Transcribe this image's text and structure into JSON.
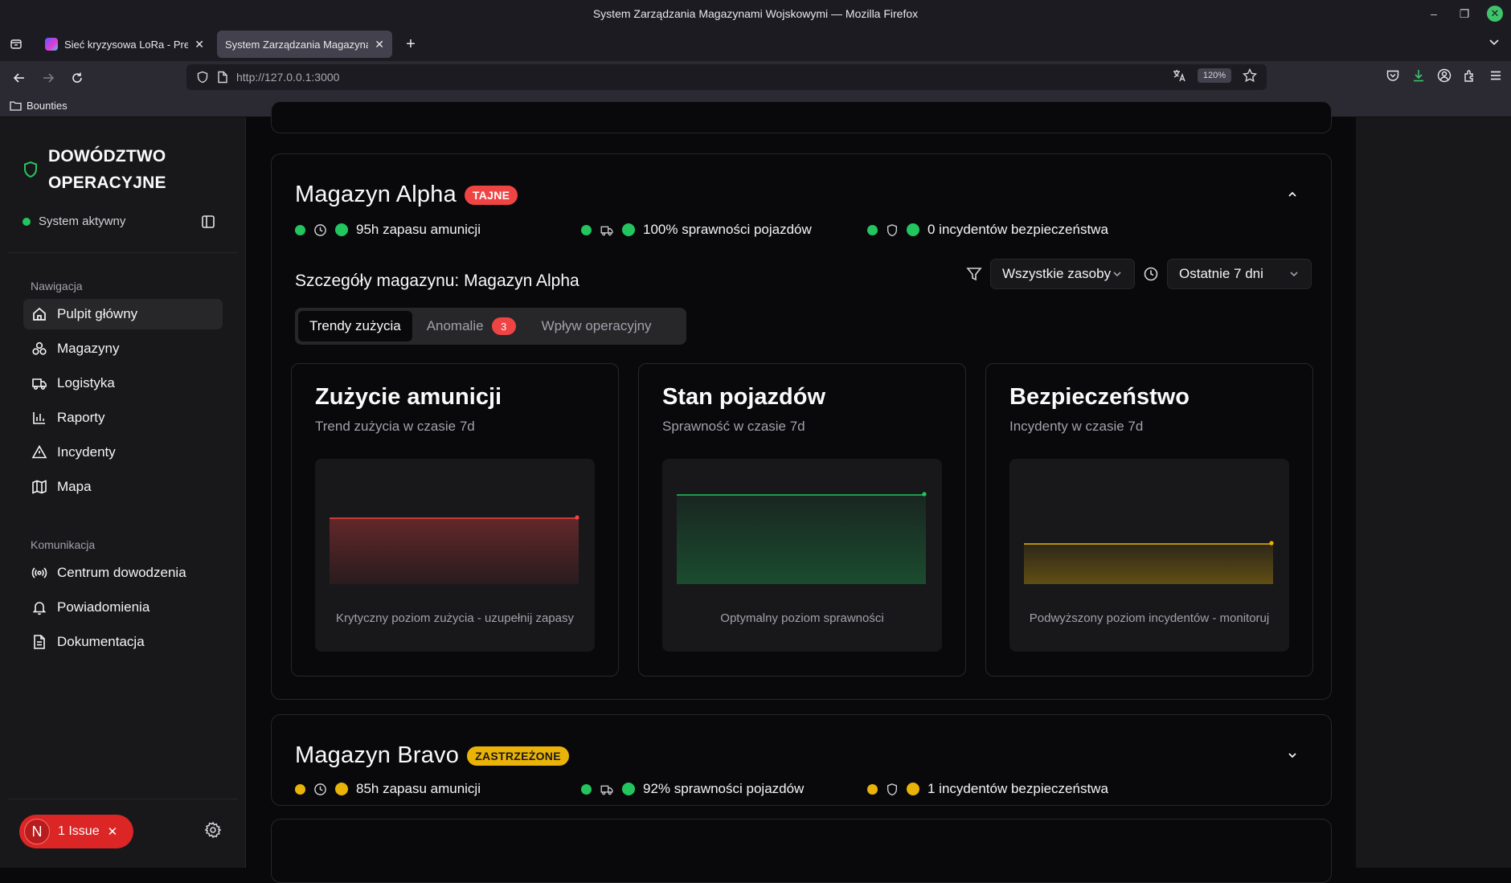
{
  "browser": {
    "window_title": "System Zarządzania Magazynami Wojskowymi — Mozilla Firefox",
    "tabs": [
      {
        "label": "Sieć kryzysowa LoRa - Prese"
      },
      {
        "label": "System Zarządzania Magazynami"
      }
    ],
    "url": "http://127.0.0.1:3000",
    "zoom": "120%",
    "bookmarks": [
      {
        "label": "Bounties"
      }
    ]
  },
  "sidebar": {
    "brand": {
      "line1": "DOWÓDZTWO",
      "line2": "OPERACYJNE"
    },
    "status": "System aktywny",
    "nav_label": "Nawigacja",
    "nav": [
      {
        "label": "Pulpit główny",
        "icon": "home-icon",
        "active": true
      },
      {
        "label": "Magazyny",
        "icon": "boxes-icon"
      },
      {
        "label": "Logistyka",
        "icon": "truck-icon"
      },
      {
        "label": "Raporty",
        "icon": "bar-chart-icon"
      },
      {
        "label": "Incydenty",
        "icon": "warning-icon"
      },
      {
        "label": "Mapa",
        "icon": "map-icon"
      }
    ],
    "comm_label": "Komunikacja",
    "comm": [
      {
        "label": "Centrum dowodzenia",
        "icon": "radio-icon"
      },
      {
        "label": "Powiadomienia",
        "icon": "bell-icon"
      },
      {
        "label": "Dokumentacja",
        "icon": "document-icon"
      }
    ],
    "issue": {
      "avatar": "N",
      "label": "1 Issue"
    }
  },
  "warehouses": [
    {
      "name": "Magazyn Alpha",
      "badge": "TAJNE",
      "badge_color": "#ef4444",
      "metrics": {
        "ammo": "95h zapasu amunicji",
        "vehicles": "100% sprawności pojazdów",
        "security": "0 incydentów bezpieczeństwa"
      },
      "metric_status": [
        "green",
        "green",
        "green"
      ]
    },
    {
      "name": "Magazyn Bravo",
      "badge": "ZASTRZEŻONE",
      "badge_color": "#eab308",
      "metrics": {
        "ammo": "85h zapasu amunicji",
        "vehicles": "92% sprawności pojazdów",
        "security": "1 incydentów bezpieczeństwa"
      },
      "metric_status": [
        "yellow",
        "green",
        "yellow"
      ]
    }
  ],
  "details": {
    "title": "Szczegóły magazynu: Magazyn Alpha",
    "filter_resources": "Wszystkie zasoby",
    "filter_period": "Ostatnie 7 dni",
    "tabs": [
      {
        "label": "Trendy zużycia",
        "active": true
      },
      {
        "label": "Anomalie",
        "count": "3"
      },
      {
        "label": "Wpływ operacyjny"
      }
    ],
    "panels": [
      {
        "title": "Zużycie amunicji",
        "subtitle": "Trend zużycia w czasie 7d",
        "note": "Krytyczny poziom zużycia - uzupełnij zapasy",
        "color": "#ef4444"
      },
      {
        "title": "Stan pojazdów",
        "subtitle": "Sprawność w czasie 7d",
        "note": "Optymalny poziom sprawności",
        "color": "#22c55e"
      },
      {
        "title": "Bezpieczeństwo",
        "subtitle": "Incydenty w czasie 7d",
        "note": "Podwyższony poziom incydentów - monitoruj",
        "color": "#eab308"
      }
    ]
  }
}
